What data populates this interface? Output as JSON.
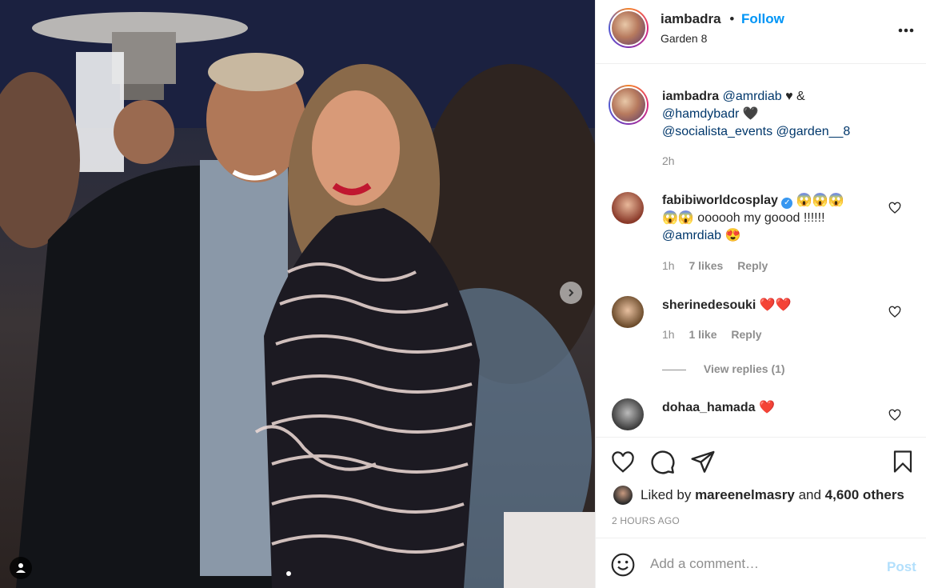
{
  "header": {
    "username": "iambadra",
    "separator": "•",
    "follow_label": "Follow",
    "location": "Garden 8",
    "more_icon": "more-horizontal-icon"
  },
  "caption": {
    "username": "iambadra",
    "mention1": "@amrdiab",
    "text1": "♥ &",
    "mention2": "@hamdybadr",
    "heart": "🖤",
    "mention3": "@socialista_events",
    "mention4": "@garden__8",
    "time": "2h"
  },
  "comments": [
    {
      "username": "fabibiworldcosplay",
      "verified": true,
      "line1_emoji": "😱😱😱",
      "line2": "😱😱 oooooh my goood !!!!!!",
      "mention": "@amrdiab",
      "mention_emoji": "😍",
      "time": "1h",
      "likes": "7 likes",
      "reply": "Reply"
    },
    {
      "username": "sherinedesouki",
      "text": "❤️❤️",
      "time": "1h",
      "likes": "1 like",
      "reply": "Reply",
      "view_replies": "View replies (1)"
    },
    {
      "username": "dohaa_hamada",
      "text": "❤️"
    }
  ],
  "actions": {
    "liked_by_prefix": "Liked by",
    "liked_by_user": "mareenelmasry",
    "liked_by_and": "and",
    "liked_by_count": "4,600 others",
    "timestamp": "2 HOURS AGO"
  },
  "comment_box": {
    "placeholder": "Add a comment…",
    "post_label": "Post"
  },
  "colors": {
    "accent": "#0095f6",
    "link": "#00376b",
    "muted": "#8e8e8e",
    "heart_red": "#ed4956"
  }
}
